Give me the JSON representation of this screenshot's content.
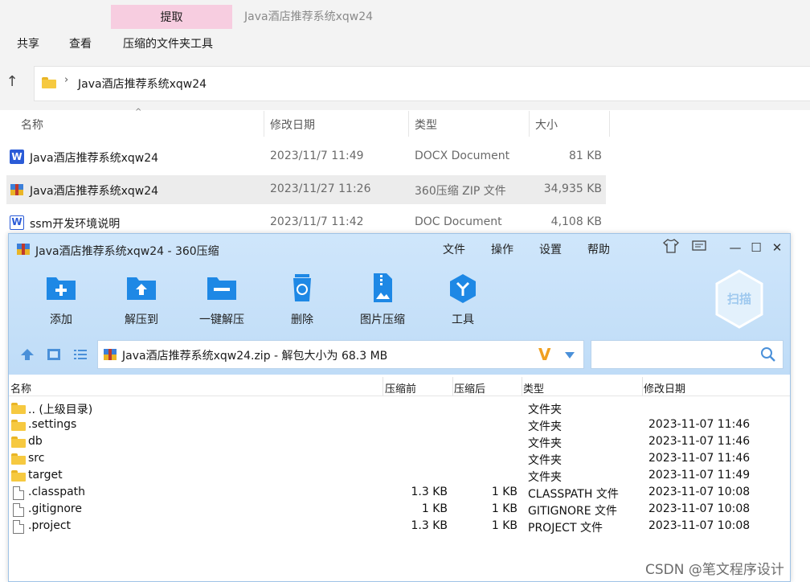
{
  "explorer": {
    "ribbon_tab_extract": "提取",
    "window_title": "Java酒店推荐系统xqw24",
    "menu": [
      "共享",
      "查看",
      "压缩的文件夹工具"
    ],
    "address_path": "Java酒店推荐系统xqw24",
    "columns": {
      "name": "名称",
      "modified": "修改日期",
      "type": "类型",
      "size": "大小"
    },
    "files": [
      {
        "name": "Java酒店推荐系统xqw24",
        "date": "2023/11/7 11:49",
        "type": "DOCX Document",
        "size": "81 KB",
        "icon": "word-docx-icon"
      },
      {
        "name": "Java酒店推荐系统xqw24",
        "date": "2023/11/27 11:26",
        "type": "360压缩 ZIP 文件",
        "size": "34,935 KB",
        "icon": "zip-archive-icon"
      },
      {
        "name": "ssm开发环境说明",
        "date": "2023/11/7 11:42",
        "type": "DOC Document",
        "size": "4,108 KB",
        "icon": "word-doc-icon"
      }
    ]
  },
  "zip": {
    "title": "Java酒店推荐系统xqw24 - 360压缩",
    "menu": [
      "文件",
      "操作",
      "设置",
      "帮助"
    ],
    "tools": [
      {
        "label": "添加",
        "icon": "add-folder-icon"
      },
      {
        "label": "解压到",
        "icon": "extract-to-icon"
      },
      {
        "label": "一键解压",
        "icon": "one-click-extract-icon"
      },
      {
        "label": "删除",
        "icon": "trash-icon"
      },
      {
        "label": "图片压缩",
        "icon": "image-compress-icon"
      },
      {
        "label": "工具",
        "icon": "tools-icon"
      }
    ],
    "scan_label": "扫描",
    "path_text": "Java酒店推荐系统xqw24.zip - 解包大小为 68.3 MB",
    "columns": {
      "name": "名称",
      "before": "压缩前",
      "after": "压缩后",
      "type": "类型",
      "modified": "修改日期"
    },
    "rows": [
      {
        "name": ".. (上级目录)",
        "before": "",
        "after": "",
        "type": "文件夹",
        "date": "",
        "kind": "folder"
      },
      {
        "name": ".settings",
        "before": "",
        "after": "",
        "type": "文件夹",
        "date": "2023-11-07 11:46",
        "kind": "folder"
      },
      {
        "name": "db",
        "before": "",
        "after": "",
        "type": "文件夹",
        "date": "2023-11-07 11:46",
        "kind": "folder"
      },
      {
        "name": "src",
        "before": "",
        "after": "",
        "type": "文件夹",
        "date": "2023-11-07 11:46",
        "kind": "folder"
      },
      {
        "name": "target",
        "before": "",
        "after": "",
        "type": "文件夹",
        "date": "2023-11-07 11:49",
        "kind": "folder"
      },
      {
        "name": ".classpath",
        "before": "1.3 KB",
        "after": "1 KB",
        "type": "CLASSPATH 文件",
        "date": "2023-11-07 10:08",
        "kind": "file"
      },
      {
        "name": ".gitignore",
        "before": "1 KB",
        "after": "1 KB",
        "type": "GITIGNORE 文件",
        "date": "2023-11-07 10:08",
        "kind": "file"
      },
      {
        "name": ".project",
        "before": "1.3 KB",
        "after": "1 KB",
        "type": "PROJECT 文件",
        "date": "2023-11-07 10:08",
        "kind": "file"
      }
    ]
  },
  "watermark": "CSDN @笔文程序设计",
  "colors": {
    "accent_blue": "#1e88e5",
    "extract_tab": "#f7cde0",
    "zip_bar": "#cfe6fb"
  }
}
